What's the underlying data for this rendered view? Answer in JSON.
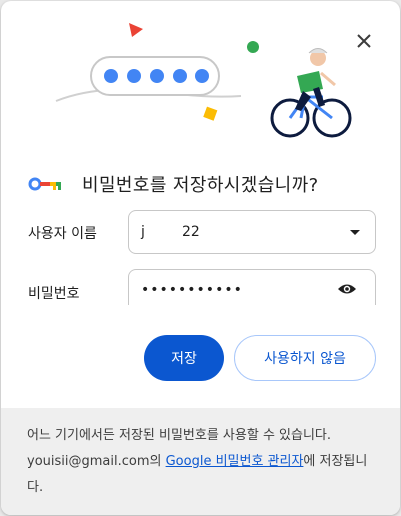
{
  "dialog": {
    "title": "비밀번호를 저장하시겠습니까?",
    "username_label": "사용자 이름",
    "username_value": "j",
    "username_value_suffix": "22",
    "password_label": "비밀번호",
    "password_mask": "•••••••••••",
    "save_label": "저장",
    "never_label": "사용하지 않음",
    "footer_text_1": "어느 기기에서든 저장된 비밀번호를 사용할 수 있습니다. youisii@gmail.com의 ",
    "footer_link": "Google 비밀번호 관리자",
    "footer_text_2": "에 저장됩니다."
  },
  "icons": {
    "close": "close-icon",
    "key": "key-icon",
    "dropdown": "chevron-down-icon",
    "eye": "eye-icon"
  },
  "colors": {
    "primary": "#0b57d0",
    "dots": "#4285f4",
    "bike_green": "#34a853",
    "triangle_red": "#ea4335",
    "yellow": "#fbbc04"
  }
}
